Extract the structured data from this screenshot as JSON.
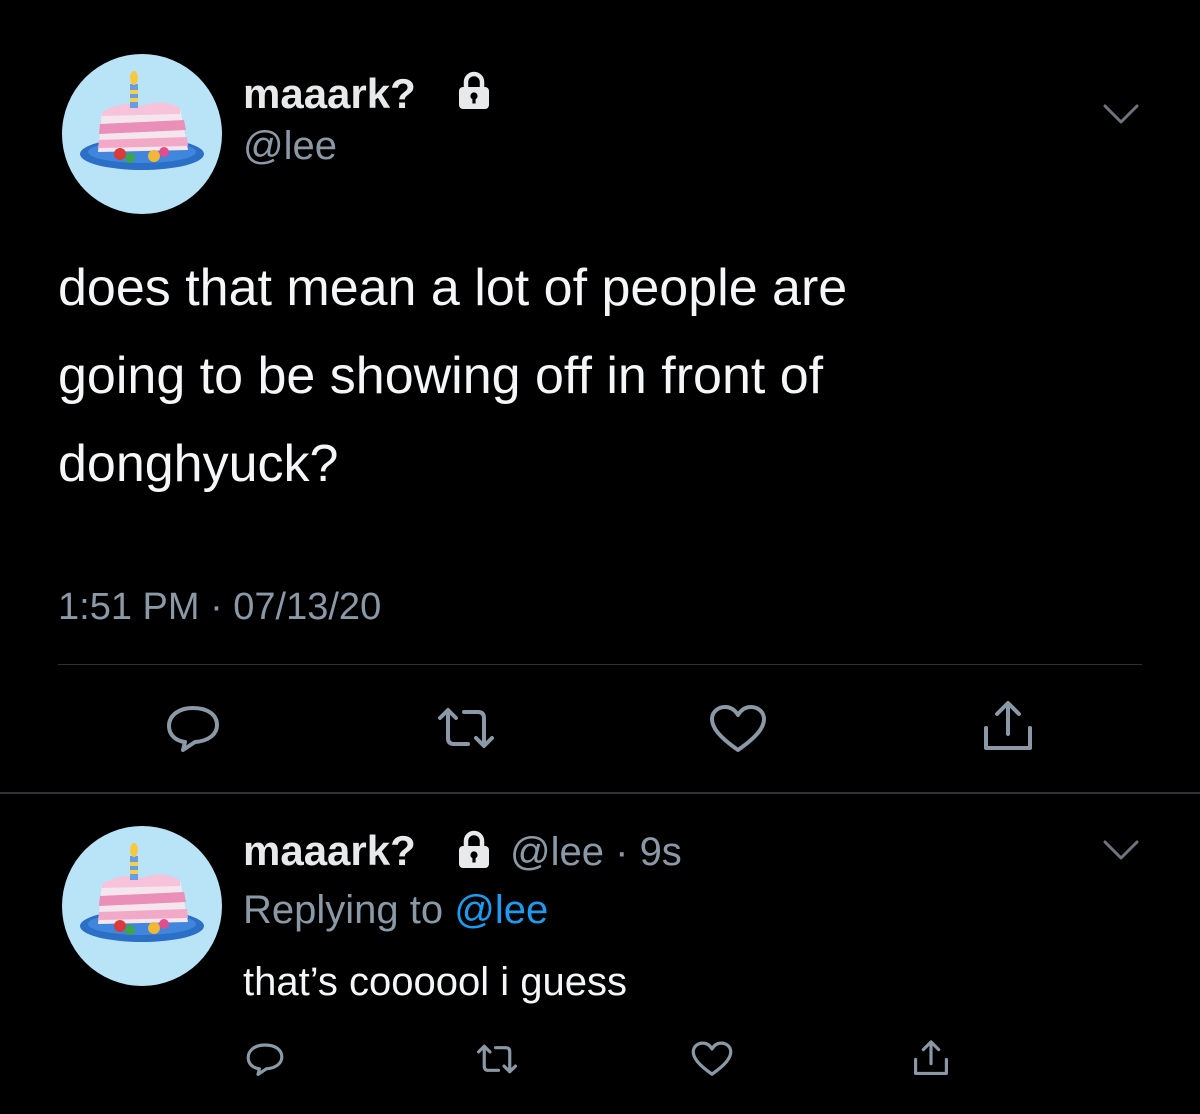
{
  "main_tweet": {
    "display_name": "maaark?",
    "handle": "@lee",
    "text_lines": [
      "does that mean a lot of people are",
      "going to be showing off in front of",
      "donghyuck?"
    ],
    "timestamp": "1:51 PM · 07/13/20"
  },
  "reply": {
    "display_name": "maaark?",
    "handle": "@lee",
    "separator": "·",
    "age": "9s",
    "replying_prefix": "Replying to",
    "replying_to": "@lee",
    "text": "that’s coooool i guess"
  },
  "icons": {
    "avatar": "birthday-cake-avatar",
    "protected": "lock-icon",
    "menu": "chevron-down-icon",
    "actions": [
      "reply-icon",
      "retweet-icon",
      "like-icon",
      "share-icon"
    ]
  },
  "colors": {
    "background": "#000000",
    "primary_text": "#e7e9ea",
    "secondary_text": "#8b98a5",
    "link": "#1d9bf0",
    "divider": "#2f3336",
    "avatar_bg": "#b9e3f7"
  }
}
